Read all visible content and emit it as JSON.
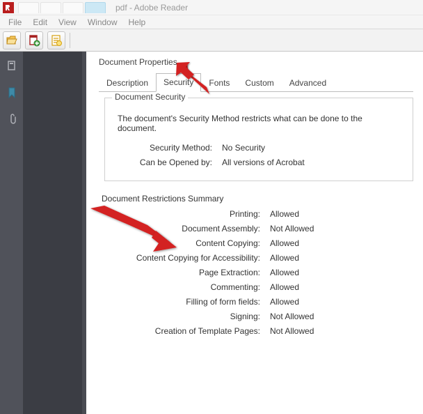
{
  "titlebar": {
    "title": "pdf - Adobe Reader"
  },
  "menubar": {
    "items": [
      "File",
      "Edit",
      "View",
      "Window",
      "Help"
    ]
  },
  "panel": {
    "title": "Document Properties",
    "tabs": [
      "Description",
      "Security",
      "Fonts",
      "Custom",
      "Advanced"
    ],
    "active_tab": "Security",
    "doc_security": {
      "legend": "Document Security",
      "desc": "The document's Security Method restricts what can be done to the document.",
      "rows": [
        {
          "k": "Security Method:",
          "v": "No Security"
        },
        {
          "k": "Can be Opened by:",
          "v": "All versions of Acrobat"
        }
      ]
    },
    "restrictions": {
      "title": "Document Restrictions Summary",
      "rows": [
        {
          "k": "Printing:",
          "v": "Allowed"
        },
        {
          "k": "Document Assembly:",
          "v": "Not Allowed"
        },
        {
          "k": "Content Copying:",
          "v": "Allowed"
        },
        {
          "k": "Content Copying for Accessibility:",
          "v": "Allowed"
        },
        {
          "k": "Page Extraction:",
          "v": "Allowed"
        },
        {
          "k": "Commenting:",
          "v": "Allowed"
        },
        {
          "k": "Filling of form fields:",
          "v": "Allowed"
        },
        {
          "k": "Signing:",
          "v": "Not Allowed"
        },
        {
          "k": "Creation of Template Pages:",
          "v": "Not Allowed"
        }
      ]
    }
  }
}
